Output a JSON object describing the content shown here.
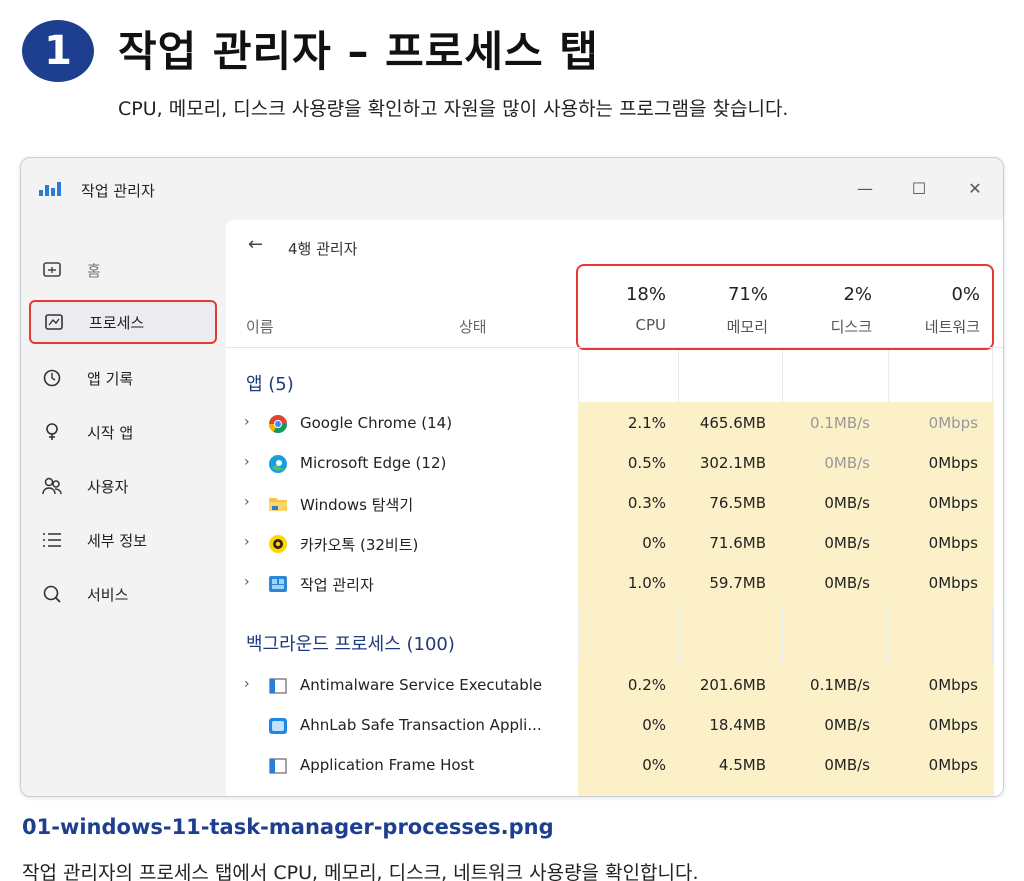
{
  "step": {
    "number": "1",
    "title": "작업 관리자 – 프로세스 탭",
    "subtitle": "CPU, 메모리, 디스크 사용량을 확인하고 자원을 많이 사용하는 프로그램을 찾습니다."
  },
  "window": {
    "title": "작업 관리자",
    "controls": {
      "minimize": "—",
      "maximize": "☐",
      "close": "✕"
    },
    "sidebar": [
      {
        "label": "홈",
        "icon": "home-icon",
        "active": false,
        "dim": true
      },
      {
        "label": "프로세스",
        "icon": "processes-icon",
        "active": true
      },
      {
        "label": "앱 기록",
        "icon": "history-icon",
        "active": false
      },
      {
        "label": "시작 앱",
        "icon": "startup-icon",
        "active": false
      },
      {
        "label": "사용자",
        "icon": "users-icon",
        "active": false
      },
      {
        "label": "세부 정보",
        "icon": "details-icon",
        "active": false
      },
      {
        "label": "서비스",
        "icon": "services-icon",
        "active": false
      }
    ],
    "content": {
      "page_title": "4행 관리자",
      "columns": {
        "name": "이름",
        "status": "상태",
        "cpu": {
          "pct": "18%",
          "label": "CPU"
        },
        "memory": {
          "pct": "71%",
          "label": "메모리"
        },
        "disk": {
          "pct": "2%",
          "label": "디스크"
        },
        "network": {
          "pct": "0%",
          "label": "네트워크"
        }
      },
      "groups": [
        {
          "title": "앱 (5)",
          "rows": [
            {
              "name": "Google Chrome (14)",
              "icon": "chrome-icon",
              "expand": true,
              "cpu": "2.1%",
              "memory": "465.6MB",
              "disk": "0.1MB/s",
              "network": "0Mbps",
              "faint_disk": true,
              "faint_net": true
            },
            {
              "name": "Microsoft Edge (12)",
              "icon": "edge-icon",
              "expand": true,
              "cpu": "0.5%",
              "memory": "302.1MB",
              "disk": "0MB/s",
              "network": "0Mbps",
              "faint_disk": true
            },
            {
              "name": "Windows 탐색기",
              "icon": "folder-icon",
              "expand": true,
              "cpu": "0.3%",
              "memory": "76.5MB",
              "disk": "0MB/s",
              "network": "0Mbps"
            },
            {
              "name": "카카오톡 (32비트)",
              "icon": "kakaotalk-icon",
              "expand": true,
              "cpu": "0%",
              "memory": "71.6MB",
              "disk": "0MB/s",
              "network": "0Mbps"
            },
            {
              "name": "작업 관리자",
              "icon": "task-manager-icon",
              "expand": true,
              "cpu": "1.0%",
              "memory": "59.7MB",
              "disk": "0MB/s",
              "network": "0Mbps"
            }
          ]
        },
        {
          "title": "백그라운드 프로세스 (100)",
          "rows": [
            {
              "name": "Antimalware Service Executable",
              "icon": "service-icon",
              "expand": true,
              "cpu": "0.2%",
              "memory": "201.6MB",
              "disk": "0.1MB/s",
              "network": "0Mbps"
            },
            {
              "name": "AhnLab Safe Transaction Appli...",
              "icon": "ahnlab-icon",
              "expand": false,
              "cpu": "0%",
              "memory": "18.4MB",
              "disk": "0MB/s",
              "network": "0Mbps"
            },
            {
              "name": "Application Frame Host",
              "icon": "service-icon",
              "expand": false,
              "cpu": "0%",
              "memory": "4.5MB",
              "disk": "0MB/s",
              "network": "0Mbps"
            }
          ]
        }
      ]
    }
  },
  "caption": {
    "file": "01-windows-11-task-manager-processes.png",
    "text": "작업 관리자의 프로세스 탭에서 CPU, 메모리, 디스크, 네트워크 사용량을 확인합니다."
  },
  "colors": {
    "accent_blue": "#1e3f8f",
    "highlight_red": "#e53935",
    "metric_fill": "#fbf0c8"
  }
}
